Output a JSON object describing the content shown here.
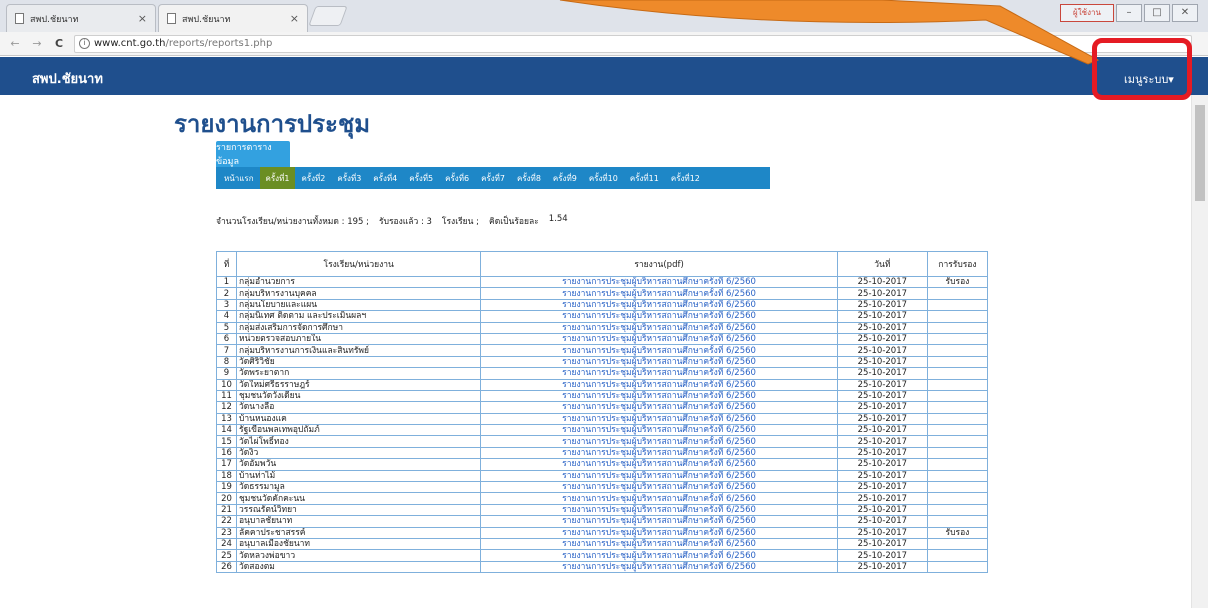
{
  "browser": {
    "tabs": [
      {
        "title": "สพป.ชัยนาท",
        "close": "×"
      },
      {
        "title": "สพป.ชัยนาท",
        "close": "×"
      }
    ],
    "window_controls": {
      "user": "ผู้ใช้งาน",
      "minimize": "–",
      "maximize": "□",
      "close": "✕"
    },
    "nav": {
      "back": "←",
      "forward": "→",
      "reload": "C"
    },
    "url": {
      "host": "www.cnt.go.th",
      "path": "/reports/reports1.php"
    }
  },
  "navbar": {
    "brand": "สพป.ชัยนาท",
    "menu": "เมนูระบบ▾"
  },
  "colors": {
    "navbar": "#1f4f8d",
    "callout": "#e51b23",
    "arrow": "#ee8a2a",
    "active_tab": "#6b8e23",
    "tabbar": "#1e87c7",
    "link": "#2a63c6"
  },
  "page": {
    "title": "รายงานการประชุม",
    "list_button": "รายการตารางข้อมูล",
    "tabs": [
      "หน้าแรก",
      "ครั้งที่1",
      "ครั้งที่2",
      "ครั้งที่3",
      "ครั้งที่4",
      "ครั้งที่5",
      "ครั้งที่6",
      "ครั้งที่7",
      "ครั้งที่8",
      "ครั้งที่9",
      "ครั้งที่10",
      "ครั้งที่11",
      "ครั้งที่12"
    ],
    "active_tab": 1,
    "summary": {
      "total_label": "จำนวนโรงเรียน/หน่วยงานทั้งหมด : 195 ;",
      "certified_label": "รับรองแล้ว : 3",
      "unit_label": "โรงเรียน ;",
      "percent_label": "คิดเป็นร้อยละ",
      "percent_value": "1.54"
    }
  },
  "table": {
    "headers": [
      "ที่",
      "โรงเรียน/หน่วยงาน",
      "รายงาน(pdf)",
      "วันที่",
      "การรับรอง"
    ],
    "report_text": "รายงานการประชุมผู้บริหารสถานศึกษาครั้งที่ 6/2560",
    "rows": [
      {
        "n": "1",
        "school": "กลุ่มอำนวยการ",
        "date": "25-10-2017",
        "cert": "รับรอง"
      },
      {
        "n": "2",
        "school": "กลุ่มบริหารงานบุคคล",
        "date": "25-10-2017",
        "cert": ""
      },
      {
        "n": "3",
        "school": "กลุ่มนโยบายและแผน",
        "date": "25-10-2017",
        "cert": ""
      },
      {
        "n": "4",
        "school": "กลุ่มนิเทศ ติดตาม และประเมินผลฯ",
        "date": "25-10-2017",
        "cert": ""
      },
      {
        "n": "5",
        "school": "กลุ่มส่งเสริมการจัดการศึกษา",
        "date": "25-10-2017",
        "cert": ""
      },
      {
        "n": "6",
        "school": "หน่วยตรวจสอบภายใน",
        "date": "25-10-2017",
        "cert": ""
      },
      {
        "n": "7",
        "school": "กลุ่มบริหารงานการเงินและสินทรัพย์",
        "date": "25-10-2017",
        "cert": ""
      },
      {
        "n": "8",
        "school": "วัดศิริวิชัย",
        "date": "25-10-2017",
        "cert": ""
      },
      {
        "n": "9",
        "school": "วัดพระยาตาก",
        "date": "25-10-2017",
        "cert": ""
      },
      {
        "n": "10",
        "school": "วัดใหม่ศรีธรราษฎร์",
        "date": "25-10-2017",
        "cert": ""
      },
      {
        "n": "11",
        "school": "ชุมชนวัดวังเดียน",
        "date": "25-10-2017",
        "cert": ""
      },
      {
        "n": "12",
        "school": "วัดนางลือ",
        "date": "25-10-2017",
        "cert": ""
      },
      {
        "n": "13",
        "school": "บ้านหนองแค",
        "date": "25-10-2017",
        "cert": ""
      },
      {
        "n": "14",
        "school": "รัฐเขื่อนพลเทพอุปถัมภ์",
        "date": "25-10-2017",
        "cert": ""
      },
      {
        "n": "15",
        "school": "วัดไผ่โพธิ์ทอง",
        "date": "25-10-2017",
        "cert": ""
      },
      {
        "n": "16",
        "school": "วัดงิ้ว",
        "date": "25-10-2017",
        "cert": ""
      },
      {
        "n": "17",
        "school": "วัดอัมพวัน",
        "date": "25-10-2017",
        "cert": ""
      },
      {
        "n": "18",
        "school": "บ้านท่าไม้",
        "date": "25-10-2017",
        "cert": ""
      },
      {
        "n": "19",
        "school": "วัดธรรมามูล",
        "date": "25-10-2017",
        "cert": ""
      },
      {
        "n": "20",
        "school": "ชุมชนวัดคักคะนน",
        "date": "25-10-2017",
        "cert": ""
      },
      {
        "n": "21",
        "school": "วรรณรัตน์วิทยา",
        "date": "25-10-2017",
        "cert": ""
      },
      {
        "n": "22",
        "school": "อนุบาลชัยนาท",
        "date": "25-10-2017",
        "cert": ""
      },
      {
        "n": "23",
        "school": "ลัคคาประชาสรรค์",
        "date": "25-10-2017",
        "cert": "รับรอง"
      },
      {
        "n": "24",
        "school": "อนุบาลเมืองชัยนาท",
        "date": "25-10-2017",
        "cert": ""
      },
      {
        "n": "25",
        "school": "วัดหลวงพ่อขาว",
        "date": "25-10-2017",
        "cert": ""
      },
      {
        "n": "26",
        "school": "วัดสองตม",
        "date": "25-10-2017",
        "cert": ""
      }
    ]
  }
}
